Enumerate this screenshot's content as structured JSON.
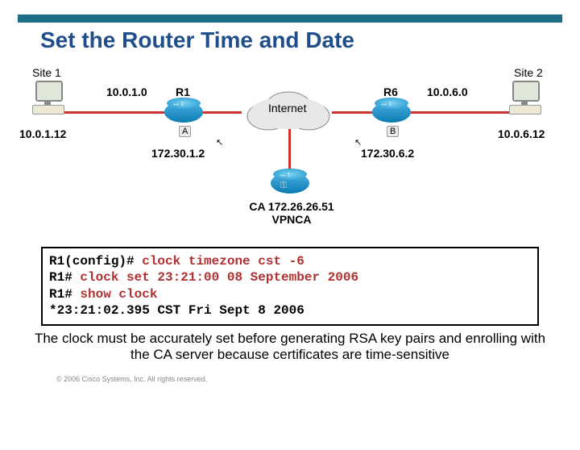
{
  "title": "Set the Router Time and Date",
  "labels": {
    "site1": "Site 1",
    "site2": "Site 2",
    "r1": "R1",
    "r6": "R6",
    "internet": "Internet",
    "ip_10_0_1_0": "10.0.1.0",
    "ip_10_0_6_0": "10.0.6.0",
    "ip_10_0_1_12": "10.0.1.12",
    "ip_10_0_6_12": "10.0.6.12",
    "ip_172_30_1_2": "172.30.1.2",
    "ip_172_30_6_2": "172.30.6.2",
    "ca_line1": "CA 172.26.26.51",
    "ca_line2": "VPNCA",
    "subA": "A",
    "subB": "B"
  },
  "terminal": {
    "l1_prompt": "R1(config)#",
    "l1_cmd": " clock timezone cst -6",
    "l2_prompt": "R1#",
    "l2_cmd": " clock set 23:21:00 08 September 2006",
    "l3_prompt": "R1#",
    "l3_cmd": " show clock",
    "l4_out": "*23:21:02.395 CST Fri Sept 8 2006"
  },
  "bottom_text": "The clock must be accurately set before generating RSA key pairs and enrolling with the CA server because certificates are time-sensitive",
  "footer": "© 2006 Cisco Systems, Inc. All rights reserved."
}
